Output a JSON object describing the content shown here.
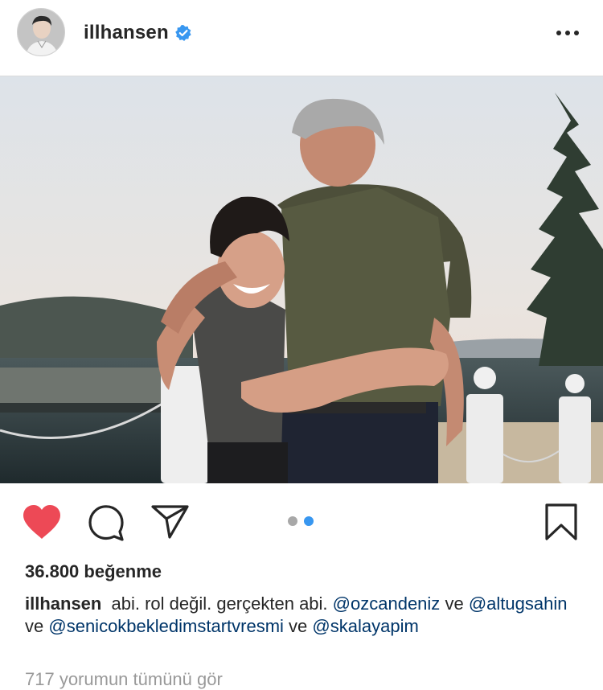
{
  "post": {
    "username": "illhansen",
    "verified": true,
    "likes": "36.800 beğenme",
    "caption": {
      "username": "illhansen",
      "text_1": "abi. rol değil. gerçekten abi.",
      "mention_1": "@ozcandeniz",
      "text_2": "ve",
      "mention_2": "@altugsahin",
      "text_3": "ve",
      "mention_3": "@senicokbekledimstartvresmi",
      "text_4": "ve",
      "mention_4": "@skalayapim"
    },
    "comments_teaser": "717 yorumun tümünü gör",
    "carousel": {
      "count": 2,
      "active": 2
    },
    "liked": true
  },
  "icons": {
    "verified": "verified-badge-icon",
    "more": "more-options-icon",
    "like": "heart-icon",
    "comment": "comment-icon",
    "share": "paper-plane-icon",
    "save": "bookmark-icon"
  },
  "colors": {
    "like_red": "#ed4956",
    "verified_blue": "#3897f0",
    "carousel_active": "#3897f0",
    "carousel_inactive": "#a8a8a8",
    "mention": "#003569"
  }
}
